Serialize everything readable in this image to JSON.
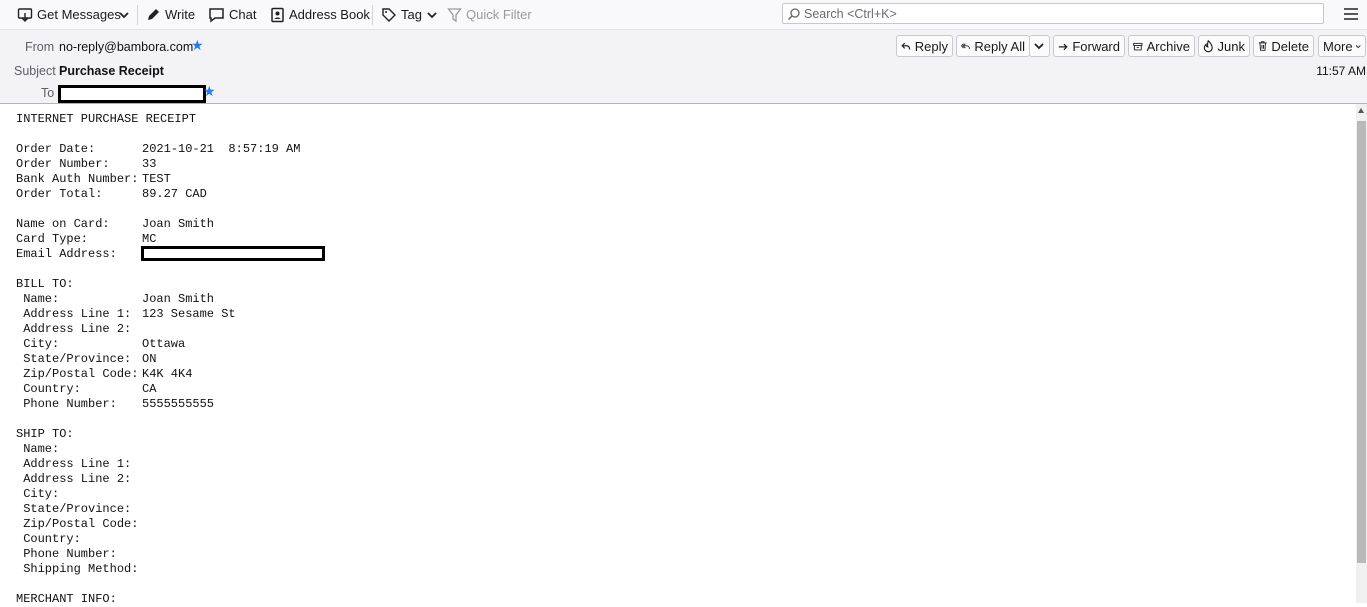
{
  "toolbar": {
    "get_messages": "Get Messages",
    "write": "Write",
    "chat": "Chat",
    "address_book": "Address Book",
    "tag": "Tag",
    "quick_filter": "Quick Filter",
    "search_placeholder": "Search <Ctrl+K>"
  },
  "header": {
    "from_label": "From",
    "from_value": "no-reply@bambora.com",
    "subject_label": "Subject",
    "subject_value": "Purchase Receipt",
    "to_label": "To",
    "time": "11:57 AM",
    "actions": {
      "reply": "Reply",
      "reply_all": "Reply All",
      "forward": "Forward",
      "archive": "Archive",
      "junk": "Junk",
      "delete": "Delete",
      "more": "More"
    }
  },
  "receipt": {
    "title": "INTERNET PURCHASE RECEIPT",
    "order_date_label": "Order Date:",
    "order_date": "2021-10-21  8:57:19 AM",
    "order_number_label": "Order Number:",
    "order_number": "33",
    "bank_auth_label": "Bank Auth Number:",
    "bank_auth": "TEST",
    "order_total_label": "Order Total:",
    "order_total": "89.27 CAD",
    "name_on_card_label": "Name on Card:",
    "name_on_card": "Joan Smith",
    "card_type_label": "Card Type:",
    "card_type": "MC",
    "email_label": "Email Address:",
    "bill_to": {
      "heading": "BILL TO:",
      "name_label": " Name:",
      "name": "Joan Smith",
      "addr1_label": " Address Line 1:",
      "addr1": "123 Sesame St",
      "addr2_label": " Address Line 2:",
      "city_label": " City:",
      "city": "Ottawa",
      "state_label": " State/Province:",
      "state": "ON",
      "zip_label": " Zip/Postal Code:",
      "zip": "K4K 4K4",
      "country_label": " Country:",
      "country": "CA",
      "phone_label": " Phone Number:",
      "phone": "5555555555"
    },
    "ship_to": {
      "heading": "SHIP TO:",
      "name_label": " Name:",
      "addr1_label": " Address Line 1:",
      "addr2_label": " Address Line 2:",
      "city_label": " City:",
      "state_label": " State/Province:",
      "zip_label": " Zip/Postal Code:",
      "country_label": " Country:",
      "phone_label": " Phone Number:",
      "shipping_label": " Shipping Method:"
    },
    "merchant_heading": "MERCHANT INFO:"
  }
}
